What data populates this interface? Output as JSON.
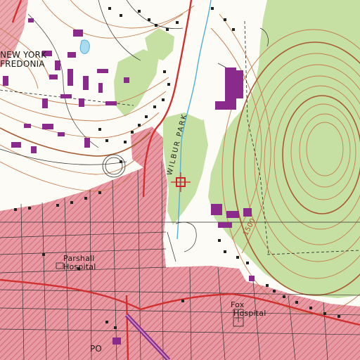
{
  "map": {
    "type": "topographic-quadrangle",
    "colors": {
      "urban_tint": "#e3919d",
      "street_hatch": "#c84a54",
      "forest": "#c6e0a4",
      "contour": "#c67d4d",
      "contour_index": "#a85a30",
      "building": "#8a2a8a",
      "road_red": "#d0302f",
      "water": "#52b0d8",
      "boundary": "#222222"
    },
    "labels": {
      "place_line1": "NEW YORK",
      "place_line2": "FREDONIA",
      "park": "WILBUR PARK",
      "hospital1_line1": "Parshall",
      "hospital1_line2": "Hospital",
      "hospital2_line1": "Fox",
      "hospital2_line2": "Hospital",
      "contour_value": "1500",
      "po": "PO"
    },
    "marker": {
      "icon": "red-square-with-crosshair"
    }
  }
}
